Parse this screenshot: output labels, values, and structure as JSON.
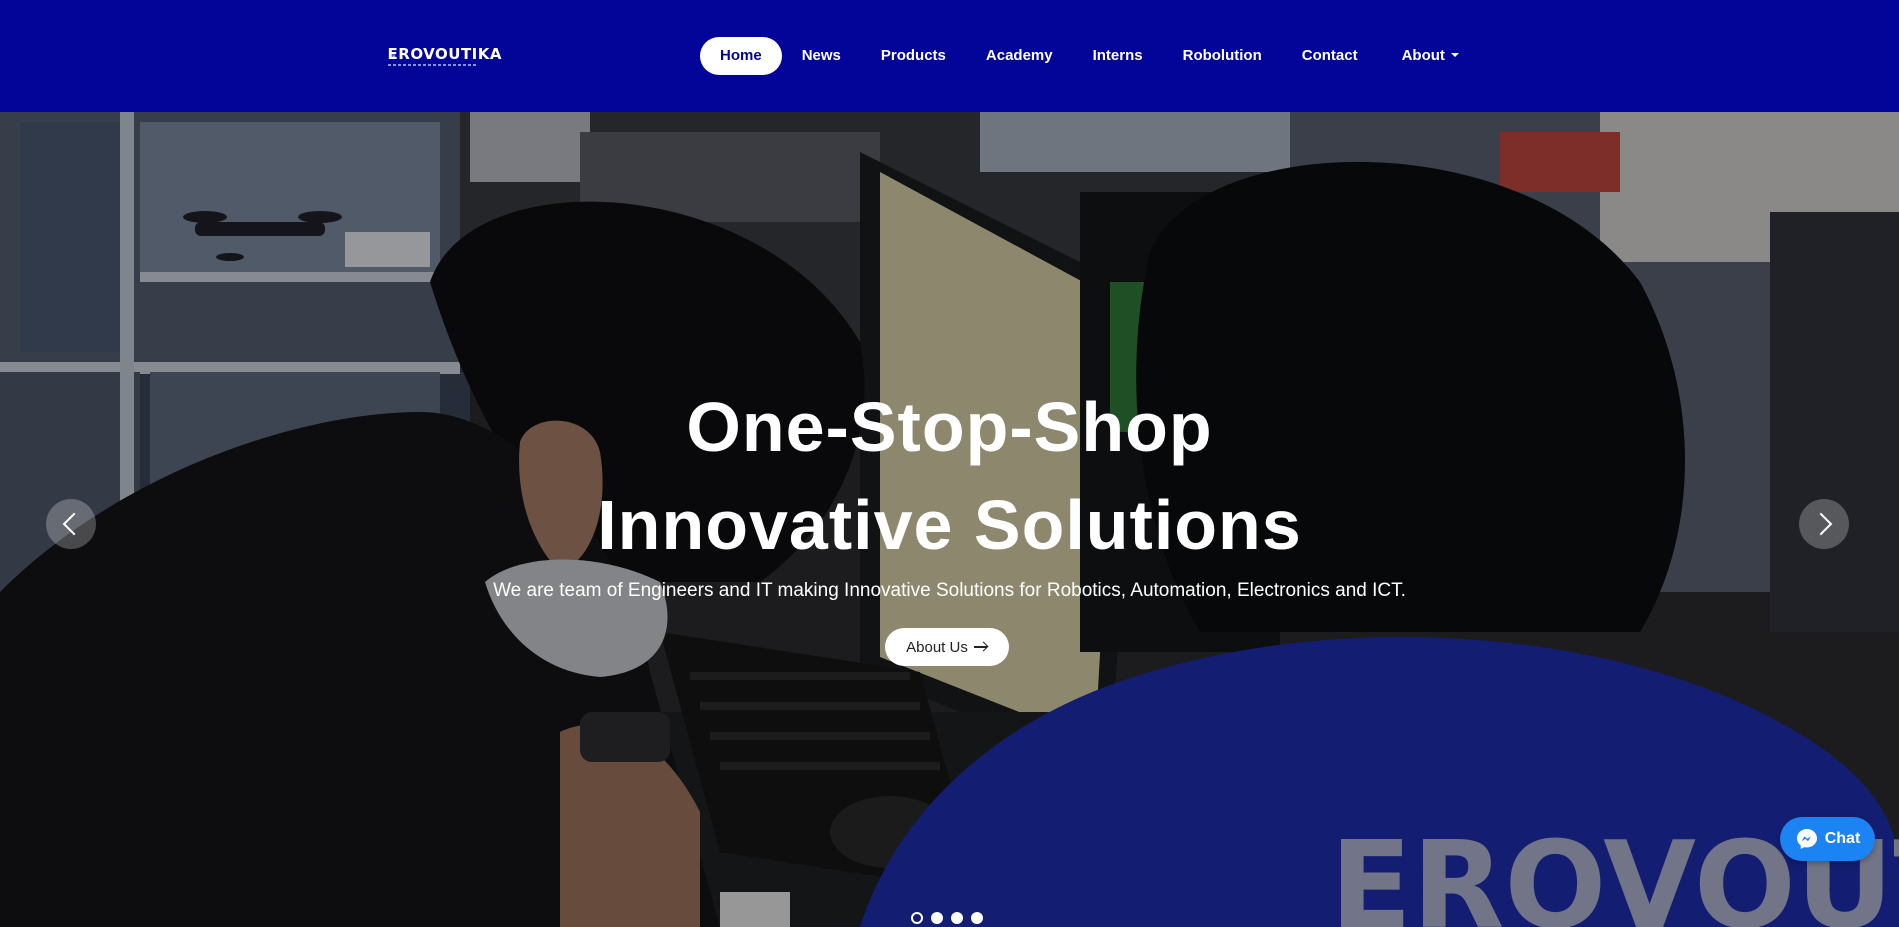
{
  "brand": {
    "logo_text": "EROVOUTIKA",
    "logo_icon": "gear-robot-arm-icon",
    "nav_color": "#020597"
  },
  "nav": {
    "items": [
      {
        "label": "Home",
        "active": true
      },
      {
        "label": "News"
      },
      {
        "label": "Products"
      },
      {
        "label": "Academy"
      },
      {
        "label": "Interns"
      },
      {
        "label": "Robolution"
      },
      {
        "label": "Contact"
      },
      {
        "label": "About",
        "has_dropdown": true
      }
    ]
  },
  "hero": {
    "title_line1": "One-Stop-Shop",
    "title_line2": "Innovative Solutions",
    "subtitle": "We are team of Engineers and IT making Innovative Solutions for Robotics, Automation, Electronics and ICT.",
    "cta_label": "About Us",
    "cta_icon": "arrow-right-icon",
    "background_shirt_text": "EROVOUTIKA",
    "slides_count": 4,
    "active_slide": 1
  },
  "chat": {
    "label": "Chat",
    "icon": "messenger-icon",
    "color": "#1c83f2"
  }
}
